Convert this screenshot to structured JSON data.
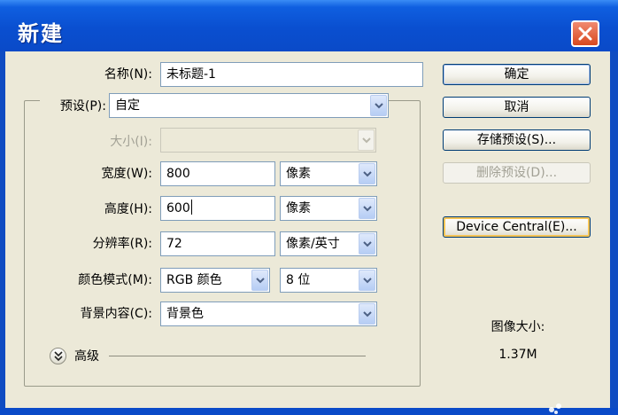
{
  "window": {
    "title": "新建"
  },
  "form": {
    "name_label": "名称(N):",
    "name_value": "未标题-1",
    "preset_label": "预设(P):",
    "preset_value": "自定",
    "size_label": "大小(I):",
    "size_value": "",
    "width_label": "宽度(W):",
    "width_value": "800",
    "width_unit": "像素",
    "height_label": "高度(H):",
    "height_value": "600",
    "height_unit": "像素",
    "resolution_label": "分辨率(R):",
    "resolution_value": "72",
    "resolution_unit": "像素/英寸",
    "color_mode_label": "颜色模式(M):",
    "color_mode_value": "RGB 颜色",
    "bit_depth_value": "8 位",
    "background_label": "背景内容(C):",
    "background_value": "背景色",
    "advanced_label": "高级"
  },
  "buttons": {
    "ok": "确定",
    "cancel": "取消",
    "save_preset": "存储预设(S)...",
    "delete_preset": "删除预设(D)...",
    "device_central": "Device Central(E)..."
  },
  "info": {
    "image_size_label": "图像大小:",
    "image_size_value": "1.37M"
  },
  "colors": {
    "titlebar": "#0a4fd0",
    "dialog_bg": "#ece9d8",
    "close_button": "#d8481e",
    "input_border": "#7f9db9"
  }
}
